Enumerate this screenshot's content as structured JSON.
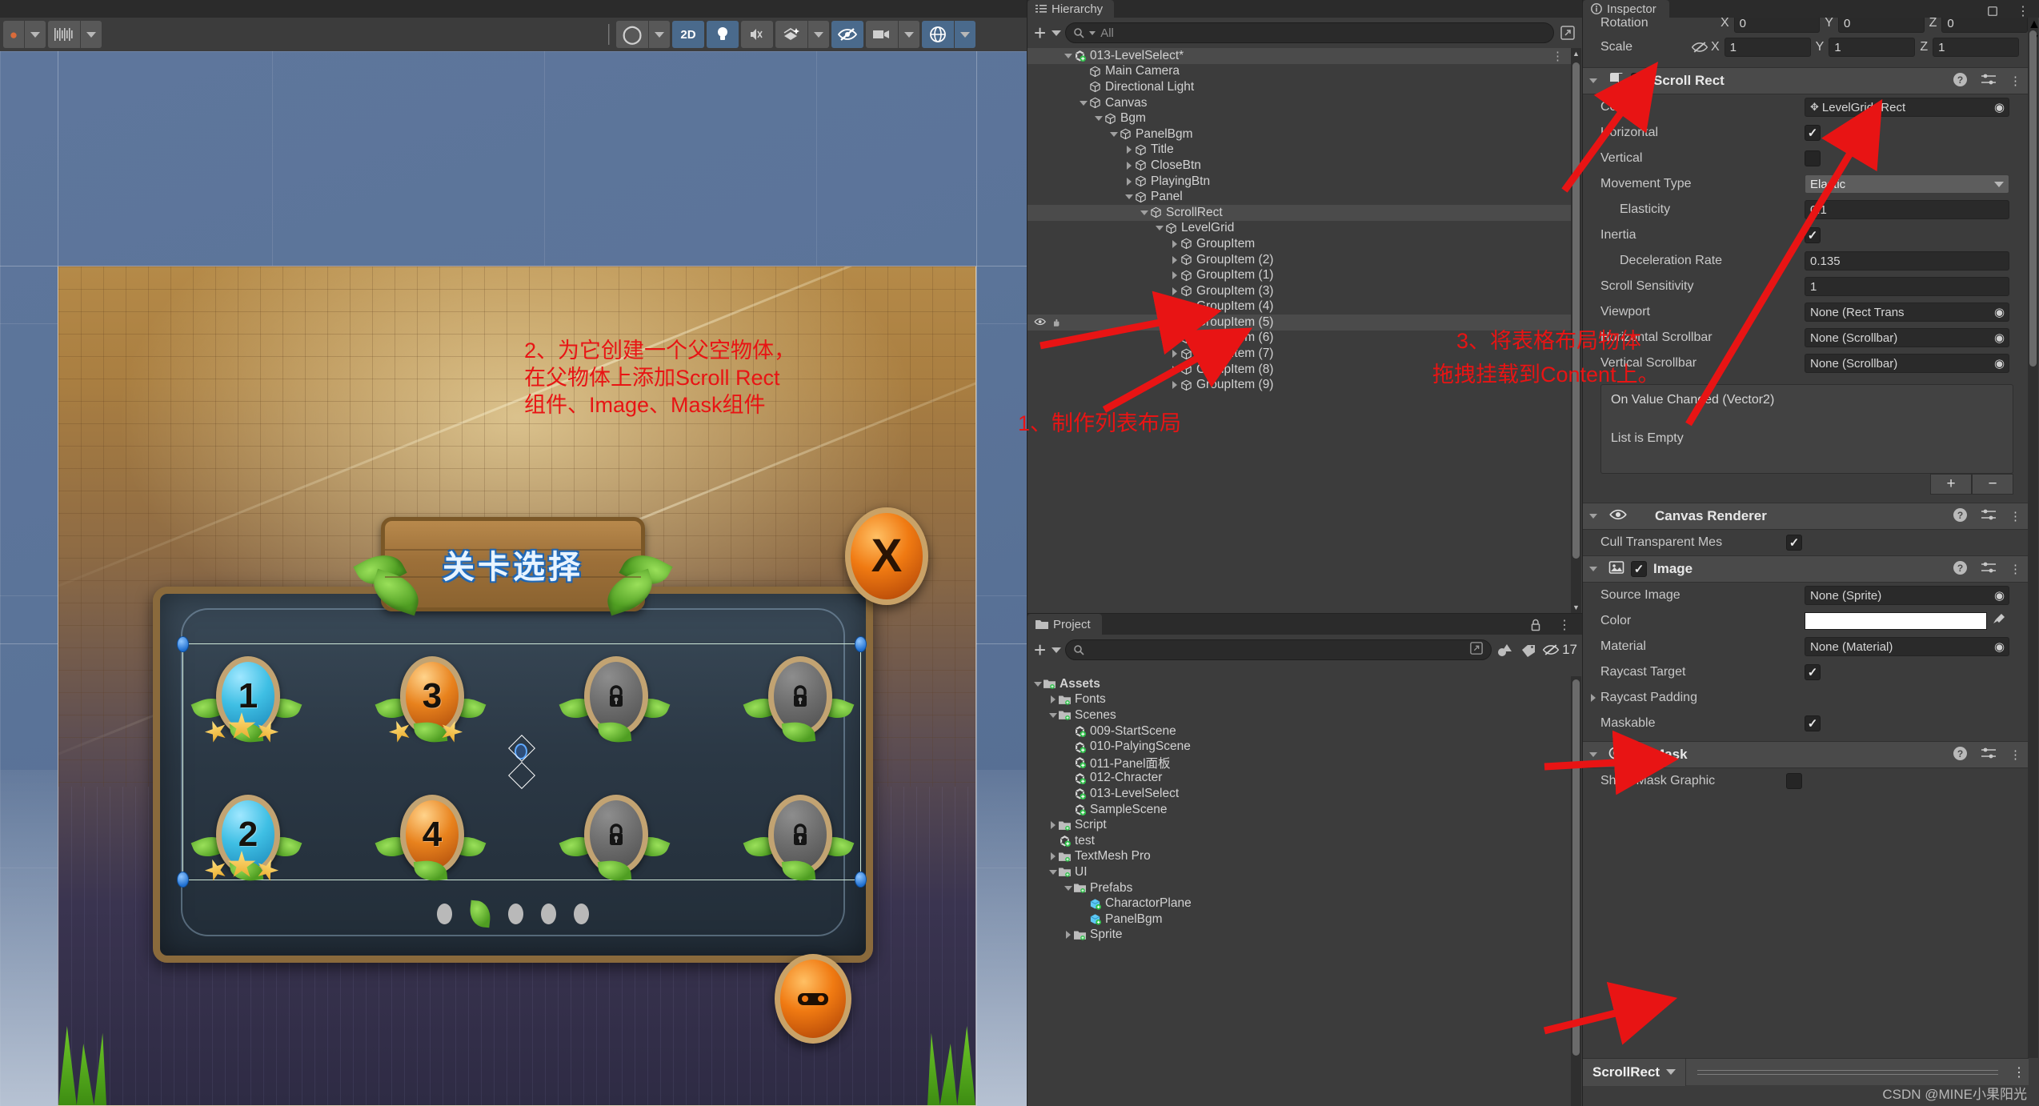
{
  "toolbar": {
    "buttons": [
      {
        "name": "account-button",
        "label": "●"
      },
      {
        "name": "account-dropdown",
        "label": "▾"
      },
      {
        "name": "layers-dropdown",
        "label": "‖‖‖"
      },
      {
        "name": "layers-dropdown-caret",
        "label": "▾"
      }
    ],
    "scene_toggles": [
      {
        "name": "draw-mode-dropdown",
        "label": "◯",
        "active": false
      },
      {
        "name": "toggle-2d",
        "label": "2D",
        "active": true
      },
      {
        "name": "toggle-lighting",
        "label": "●",
        "active": true
      },
      {
        "name": "toggle-audio",
        "label": "🔇",
        "active": false
      },
      {
        "name": "toggle-fx",
        "label": "✧",
        "active": false
      },
      {
        "name": "fx-dropdown",
        "label": "▾",
        "active": false
      },
      {
        "name": "toggle-scene-visibility",
        "label": "◎",
        "active": true
      },
      {
        "name": "toggle-camera",
        "label": "■",
        "active": false
      },
      {
        "name": "camera-dropdown",
        "label": "▾",
        "active": false
      },
      {
        "name": "toggle-gizmos",
        "label": "◑",
        "active": true
      },
      {
        "name": "gizmos-dropdown",
        "label": "▾",
        "active": false
      }
    ]
  },
  "scene": {
    "title_text": "关卡选择",
    "close_label": "X",
    "gamepad_label": "⬚",
    "levels_row1": [
      {
        "name": "level-1",
        "label": "1",
        "state": "open",
        "stars": 3
      },
      {
        "name": "level-3",
        "label": "3",
        "state": "orange",
        "stars": 2
      },
      {
        "name": "level-locked-a",
        "label": "🔒",
        "state": "locked",
        "stars": 0
      },
      {
        "name": "level-locked-b",
        "label": "🔒",
        "state": "locked",
        "stars": 0
      }
    ],
    "levels_row2": [
      {
        "name": "level-2",
        "label": "2",
        "state": "open",
        "stars": 3
      },
      {
        "name": "level-4",
        "label": "4",
        "state": "orange",
        "stars": 0
      },
      {
        "name": "level-locked-c",
        "label": "🔒",
        "state": "locked",
        "stars": 0
      },
      {
        "name": "level-locked-d",
        "label": "🔒",
        "state": "locked",
        "stars": 0
      }
    ],
    "page_dots": 5,
    "active_dot_index": 1
  },
  "annotations": {
    "step1": "1、制作列表布局",
    "step2_line1": "2、为它创建一个父空物体，",
    "step2_line2": "在父物体上添加Scroll Rect",
    "step2_line3": "组件、Image、Mask组件",
    "step3_line1": "3、将表格布局物体",
    "step3_line2": "拖拽挂载到Content上。"
  },
  "hierarchy": {
    "tab_label": "Hierarchy",
    "add_label": "+",
    "add_caret": "▾",
    "search_placeholder": "All",
    "items": [
      {
        "label": "013-LevelSelect*",
        "depth": 0,
        "tri": "down",
        "icon": "unity-scene-icon",
        "selected": true,
        "dots": true
      },
      {
        "label": "Main Camera",
        "depth": 1,
        "tri": "none",
        "icon": "gameobject-icon"
      },
      {
        "label": "Directional Light",
        "depth": 1,
        "tri": "none",
        "icon": "gameobject-icon"
      },
      {
        "label": "Canvas",
        "depth": 1,
        "tri": "down",
        "icon": "gameobject-icon"
      },
      {
        "label": "Bgm",
        "depth": 2,
        "tri": "down",
        "icon": "gameobject-icon"
      },
      {
        "label": "PanelBgm",
        "depth": 3,
        "tri": "down",
        "icon": "gameobject-icon"
      },
      {
        "label": "Title",
        "depth": 4,
        "tri": "right",
        "icon": "gameobject-icon"
      },
      {
        "label": "CloseBtn",
        "depth": 4,
        "tri": "right",
        "icon": "gameobject-icon"
      },
      {
        "label": "PlayingBtn",
        "depth": 4,
        "tri": "right",
        "icon": "gameobject-icon"
      },
      {
        "label": "Panel",
        "depth": 4,
        "tri": "down",
        "icon": "gameobject-icon"
      },
      {
        "label": "ScrollRect",
        "depth": 5,
        "tri": "down",
        "icon": "gameobject-icon",
        "selected": true
      },
      {
        "label": "LevelGrid",
        "depth": 6,
        "tri": "down",
        "icon": "gameobject-icon"
      },
      {
        "label": "GroupItem",
        "depth": 7,
        "tri": "right",
        "icon": "gameobject-icon"
      },
      {
        "label": "GroupItem (2)",
        "depth": 7,
        "tri": "right",
        "icon": "gameobject-icon"
      },
      {
        "label": "GroupItem (1)",
        "depth": 7,
        "tri": "right",
        "icon": "gameobject-icon"
      },
      {
        "label": "GroupItem (3)",
        "depth": 7,
        "tri": "right",
        "icon": "gameobject-icon"
      },
      {
        "label": "GroupItem (4)",
        "depth": 7,
        "tri": "right",
        "icon": "gameobject-icon"
      },
      {
        "label": "GroupItem (5)",
        "depth": 7,
        "tri": "right",
        "icon": "gameobject-icon",
        "hovered": true
      },
      {
        "label": "GroupItem (6)",
        "depth": 7,
        "tri": "right",
        "icon": "gameobject-icon"
      },
      {
        "label": "GroupItem (7)",
        "depth": 7,
        "tri": "right",
        "icon": "gameobject-icon"
      },
      {
        "label": "GroupItem (8)",
        "depth": 7,
        "tri": "right",
        "icon": "gameobject-icon"
      },
      {
        "label": "GroupItem (9)",
        "depth": 7,
        "tri": "right",
        "icon": "gameobject-icon"
      }
    ]
  },
  "project": {
    "tab_label": "Project",
    "add_label": "+",
    "add_caret": "▾",
    "search_placeholder": "",
    "hidden_count": "17",
    "items": [
      {
        "label": "Assets",
        "depth": 0,
        "tri": "down",
        "icon": "folder-icon",
        "bold": true
      },
      {
        "label": "Fonts",
        "depth": 1,
        "tri": "right",
        "icon": "folder-icon"
      },
      {
        "label": "Scenes",
        "depth": 1,
        "tri": "down",
        "icon": "folder-icon"
      },
      {
        "label": "009-StartScene",
        "depth": 2,
        "tri": "none",
        "icon": "unity-scene-icon"
      },
      {
        "label": "010-PalyingScene",
        "depth": 2,
        "tri": "none",
        "icon": "unity-scene-icon"
      },
      {
        "label": "011-Panel面板",
        "depth": 2,
        "tri": "none",
        "icon": "unity-scene-icon"
      },
      {
        "label": "012-Chracter",
        "depth": 2,
        "tri": "none",
        "icon": "unity-scene-icon"
      },
      {
        "label": "013-LevelSelect",
        "depth": 2,
        "tri": "none",
        "icon": "unity-scene-icon"
      },
      {
        "label": "SampleScene",
        "depth": 2,
        "tri": "none",
        "icon": "unity-scene-icon"
      },
      {
        "label": "Script",
        "depth": 1,
        "tri": "right",
        "icon": "folder-icon"
      },
      {
        "label": "test",
        "depth": 1,
        "tri": "none",
        "icon": "unity-scene-icon"
      },
      {
        "label": "TextMesh Pro",
        "depth": 1,
        "tri": "right",
        "icon": "folder-icon"
      },
      {
        "label": "UI",
        "depth": 1,
        "tri": "down",
        "icon": "folder-icon"
      },
      {
        "label": "Prefabs",
        "depth": 2,
        "tri": "down",
        "icon": "folder-icon"
      },
      {
        "label": "CharactorPlane",
        "depth": 3,
        "tri": "none",
        "icon": "prefab-icon"
      },
      {
        "label": "PanelBgm",
        "depth": 3,
        "tri": "none",
        "icon": "prefab-icon"
      },
      {
        "label": "Sprite",
        "depth": 2,
        "tri": "right",
        "icon": "folder-icon"
      }
    ]
  },
  "inspector": {
    "tab_label": "Inspector",
    "transform_rows": [
      {
        "label": "Rotation",
        "x": "0",
        "y": "0",
        "z": "0"
      },
      {
        "label": "Scale",
        "x": "1",
        "y": "1",
        "z": "1"
      }
    ],
    "axis_labels": {
      "x": "X",
      "y": "Y",
      "z": "Z"
    },
    "components": [
      {
        "name": "scroll-rect",
        "title": "Scroll Rect",
        "enabled": true,
        "icon": "scroll-rect-icon",
        "fields": [
          {
            "label": "Content",
            "type": "object",
            "value": "LevelGrid (Rect",
            "indent": 0
          },
          {
            "label": "Horizontal",
            "type": "checkbox",
            "value": true,
            "indent": 0
          },
          {
            "label": "Vertical",
            "type": "checkbox",
            "value": false,
            "indent": 0
          },
          {
            "label": "Movement Type",
            "type": "dropdown",
            "value": "Elastic",
            "indent": 0
          },
          {
            "label": "Elasticity",
            "type": "text",
            "value": "0.1",
            "indent": 1
          },
          {
            "label": "Inertia",
            "type": "checkbox",
            "value": true,
            "indent": 0
          },
          {
            "label": "Deceleration Rate",
            "type": "text",
            "value": "0.135",
            "indent": 1
          },
          {
            "label": "Scroll Sensitivity",
            "type": "text",
            "value": "1",
            "indent": 0
          },
          {
            "label": "Viewport",
            "type": "object",
            "value": "None (Rect Trans",
            "indent": 0
          },
          {
            "label": "Horizontal Scrollbar",
            "type": "object",
            "value": "None (Scrollbar)",
            "indent": 0
          },
          {
            "label": "Vertical Scrollbar",
            "type": "object",
            "value": "None (Scrollbar)",
            "indent": 0
          }
        ],
        "event": {
          "title": "On Value Changed (Vector2)",
          "empty_text": "List is Empty",
          "add": "+",
          "remove": "−"
        }
      },
      {
        "name": "canvas-renderer",
        "title": "Canvas Renderer",
        "enabled": null,
        "icon": "eye-icon",
        "fields": [
          {
            "label": "Cull Transparent Mes",
            "type": "checkbox",
            "value": true,
            "indent": 0
          }
        ]
      },
      {
        "name": "image",
        "title": "Image",
        "enabled": true,
        "icon": "image-icon",
        "fields": [
          {
            "label": "Source Image",
            "type": "object",
            "value": "None (Sprite)",
            "indent": 0
          },
          {
            "label": "Color",
            "type": "color",
            "value": "#ffffff",
            "indent": 0
          },
          {
            "label": "Material",
            "type": "object",
            "value": "None (Material)",
            "indent": 0
          },
          {
            "label": "Raycast Target",
            "type": "checkbox",
            "value": true,
            "indent": 0
          },
          {
            "label": "Raycast Padding",
            "type": "foldout",
            "value": "",
            "indent": 0
          },
          {
            "label": "Maskable",
            "type": "checkbox",
            "value": true,
            "indent": 0
          }
        ]
      },
      {
        "name": "mask",
        "title": "Mask",
        "enabled": true,
        "icon": "mask-icon",
        "fields": [
          {
            "label": "Show Mask Graphic",
            "type": "checkbox",
            "value": false,
            "indent": 0
          }
        ]
      }
    ],
    "footer_chip": "ScrollRect",
    "footer_caret": "▾",
    "watermark": "CSDN @MINE小果阳光"
  }
}
